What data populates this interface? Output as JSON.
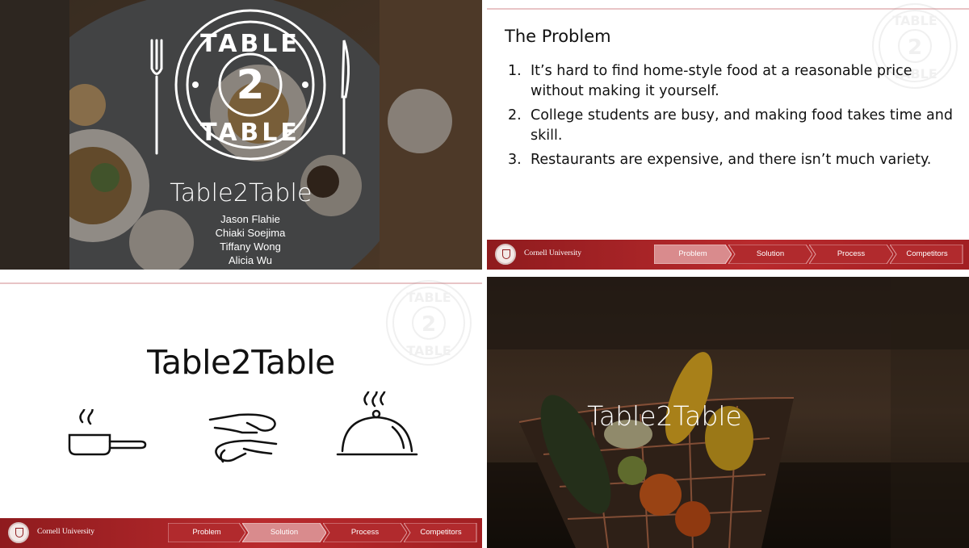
{
  "slide1": {
    "logo_word_top": "TABLE",
    "logo_word_bottom": "TABLE",
    "logo_number": "2",
    "title": "Table2Table",
    "authors": [
      "Jason Flahie",
      "Chiaki Soejima",
      "Tiffany Wong",
      "Alicia Wu"
    ]
  },
  "slide2": {
    "heading": "The Problem",
    "items": [
      {
        "num": "1.",
        "text": "It’s hard to find home-style food at a reasonable price without making it yourself."
      },
      {
        "num": "2.",
        "text": "College students are busy, and making food takes time and skill."
      },
      {
        "num": "3.",
        "text": "Restaurants are expensive, and there isn’t much variety."
      }
    ],
    "footer": {
      "university": "Cornell University",
      "nav": [
        "Problem",
        "Solution",
        "Process",
        "Competitors"
      ],
      "active": 0
    }
  },
  "slide3": {
    "title": "Table2Table",
    "icons": [
      "frying-pan-icon",
      "hands-icon",
      "serving-cloche-icon"
    ],
    "footer": {
      "university": "Cornell University",
      "nav": [
        "Problem",
        "Solution",
        "Process",
        "Competitors"
      ],
      "active": 1
    }
  },
  "slide4": {
    "title": "Table2Table"
  },
  "colors": {
    "footer_red": "#a21f22",
    "active_tab": "#d98b8d",
    "accent_line": "#e8c4c6"
  },
  "watermark": {
    "word_top": "TABLE",
    "word_bottom": "TABLE",
    "number": "2"
  }
}
